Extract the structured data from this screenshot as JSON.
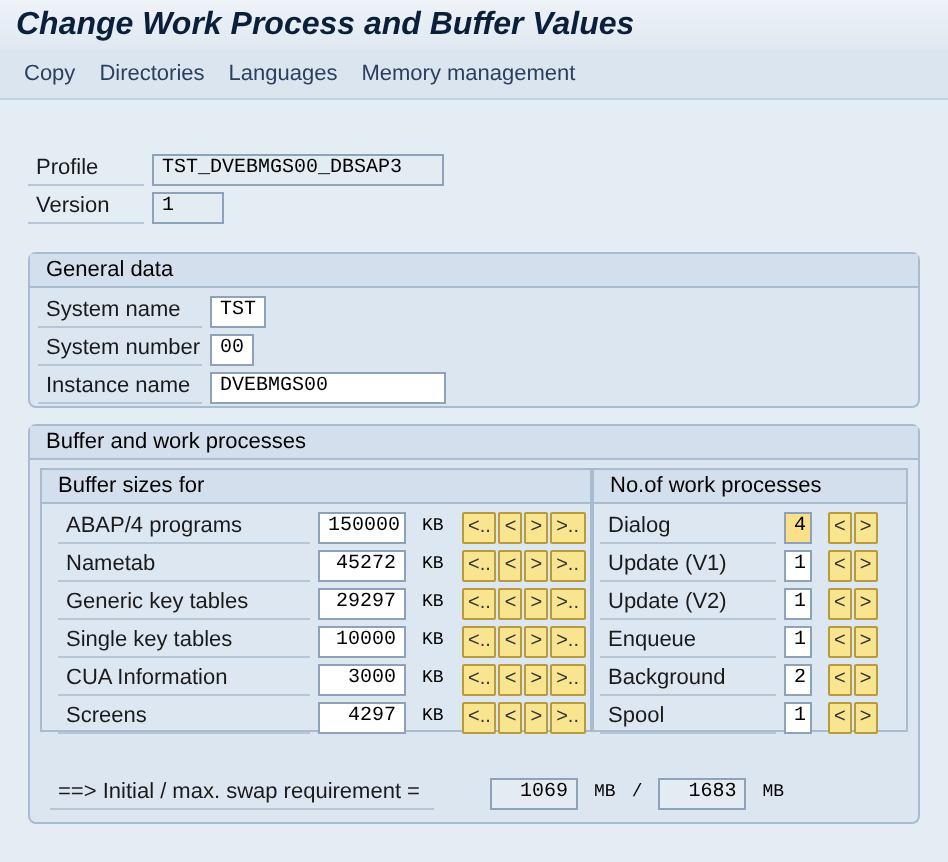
{
  "title": "Change Work Process and Buffer Values",
  "menu": [
    "Copy",
    "Directories",
    "Languages",
    "Memory management"
  ],
  "header_fields": [
    {
      "label": "Profile",
      "value": "TST_DVEBMGS00_DBSAP3"
    },
    {
      "label": "Version",
      "value": "1"
    }
  ],
  "general_data": {
    "title": "General data",
    "fields": [
      {
        "label": "System name",
        "value": "TST"
      },
      {
        "label": "System number",
        "value": "00"
      },
      {
        "label": "Instance name",
        "value": "DVEBMGS00"
      }
    ]
  },
  "buffer_section": {
    "title": "Buffer and work processes",
    "buffer_sizes": {
      "title": "Buffer sizes for",
      "rows": [
        {
          "label": "ABAP/4 programs",
          "value": "150000",
          "unit": "KB",
          "buttons": [
            "<..",
            "<",
            ">",
            ">.."
          ]
        },
        {
          "label": "Nametab",
          "value": "45272",
          "unit": "KB",
          "buttons": [
            "<..",
            "<",
            ">",
            ">.."
          ]
        },
        {
          "label": "Generic key tables",
          "value": "29297",
          "unit": "KB",
          "buttons": [
            "<..",
            "<",
            ">",
            ">.."
          ]
        },
        {
          "label": "Single key tables",
          "value": "10000",
          "unit": "KB",
          "buttons": [
            "<..",
            "<",
            ">",
            ">.."
          ]
        },
        {
          "label": "CUA Information",
          "value": "3000",
          "unit": "KB",
          "buttons": [
            "<..",
            "<",
            ">",
            ">.."
          ]
        },
        {
          "label": "Screens",
          "value": "4297",
          "unit": "KB",
          "buttons": [
            "<..",
            "<",
            ">",
            ">.."
          ]
        }
      ]
    },
    "work_processes": {
      "title": "No.of work processes",
      "rows": [
        {
          "label": "Dialog",
          "value": "4",
          "focused": true,
          "buttons": [
            "<",
            ">"
          ]
        },
        {
          "label": "Update (V1)",
          "value": "1",
          "focused": false,
          "buttons": [
            "<",
            ">"
          ]
        },
        {
          "label": "Update (V2)",
          "value": "1",
          "focused": false,
          "buttons": [
            "<",
            ">"
          ]
        },
        {
          "label": "Enqueue",
          "value": "1",
          "focused": false,
          "buttons": [
            "<",
            ">"
          ]
        },
        {
          "label": "Background",
          "value": "2",
          "focused": false,
          "buttons": [
            "<",
            ">"
          ]
        },
        {
          "label": "Spool",
          "value": "1",
          "focused": false,
          "buttons": [
            "<",
            ">"
          ]
        }
      ]
    },
    "swap": {
      "label": "==> Initial / max. swap requirement =",
      "initial": "1069",
      "unit_1": "MB",
      "separator": "/",
      "max": "1683",
      "unit_2": "MB"
    }
  }
}
